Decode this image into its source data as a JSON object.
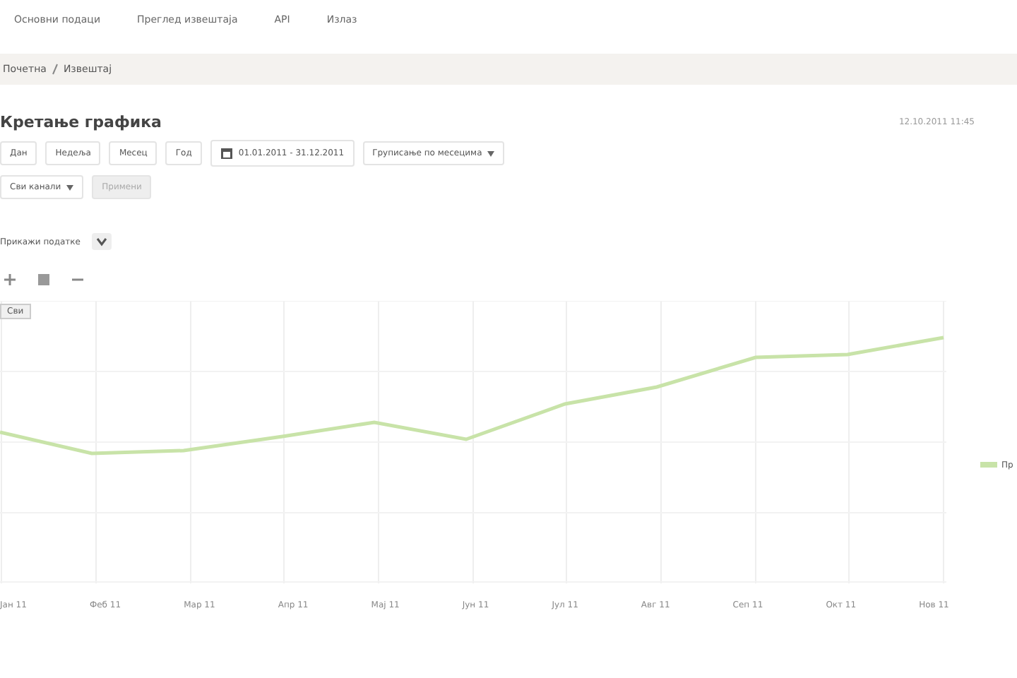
{
  "nav": [
    "Основни подаци",
    "Преглед извештаја",
    "API",
    "Излаз"
  ],
  "breadcrumb": [
    "Почетна",
    "Извештај"
  ],
  "page": {
    "title": "Кретање графика",
    "timestamp": "12.10.2011 11:45"
  },
  "periods": [
    {
      "label": "Дан",
      "selected": false
    },
    {
      "label": "Недеља",
      "selected": false
    },
    {
      "label": "Месец",
      "selected": false
    },
    {
      "label": "Год",
      "selected": false
    }
  ],
  "date_range": "01.01.2011 - 31.12.2011",
  "grouping": {
    "value": "Груписање по месецима"
  },
  "channel": {
    "value": "Сви канали"
  },
  "apply_button": {
    "label": "Примени",
    "disabled": true
  },
  "data_toggle": {
    "label": "Прикажи податке"
  },
  "chart": {
    "badge": "Сви",
    "categories": [
      "Јан 11",
      "Феб 11",
      "Мар 11",
      "Апр 11",
      "Мај 11",
      "Јун 11",
      "Јул 11",
      "Авг 11",
      "Сеп 11",
      "Окт 11",
      "Нов 11"
    ],
    "legend": [
      {
        "label": "Пр",
        "color": "#c8e3a8"
      }
    ]
  }
}
